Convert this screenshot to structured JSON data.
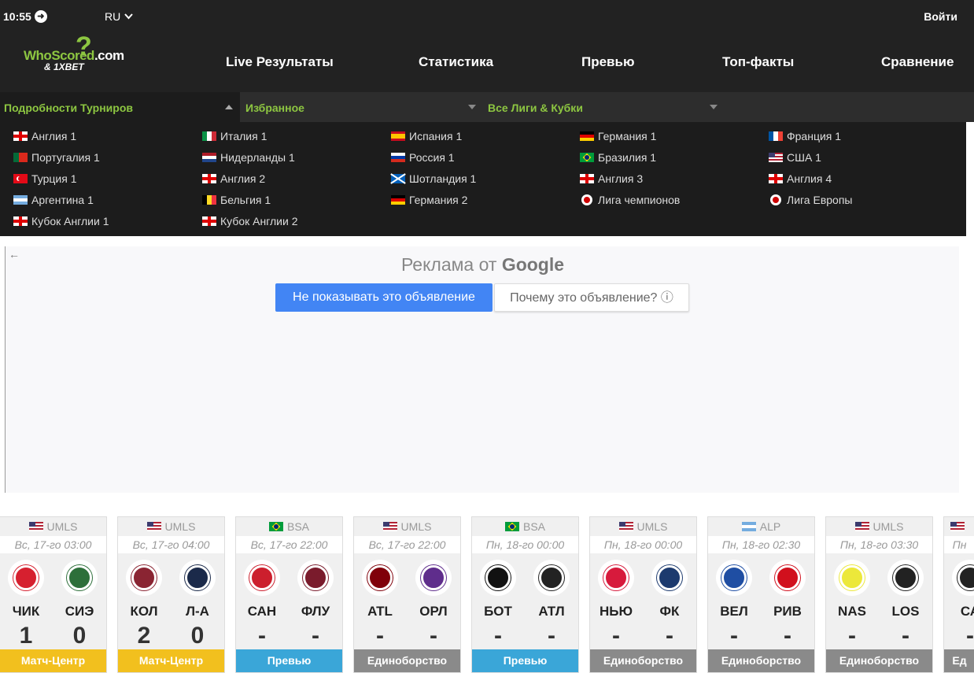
{
  "status": {
    "time": "10:55",
    "lang": "RU",
    "login": "Войти"
  },
  "logo": {
    "part1": "WhoScored",
    "part2": ".com",
    "part3": "& 1XBET"
  },
  "nav": [
    "Live Результаты",
    "Статистика",
    "Превью",
    "Топ-факты",
    "Сравнение"
  ],
  "tabs": {
    "active": "Подробности Турниров",
    "fav": "Избранное",
    "all": "Все Лиги & Кубки"
  },
  "leagues": [
    {
      "name": "Англия 1",
      "flag": "eng"
    },
    {
      "name": "Италия 1",
      "flag": "ita"
    },
    {
      "name": "Испания 1",
      "flag": "esp"
    },
    {
      "name": "Германия 1",
      "flag": "ger"
    },
    {
      "name": "Франция 1",
      "flag": "fra"
    },
    {
      "name": "Португалия 1",
      "flag": "por"
    },
    {
      "name": "Нидерланды 1",
      "flag": "ned"
    },
    {
      "name": "Россия 1",
      "flag": "rus"
    },
    {
      "name": "Бразилия 1",
      "flag": "bra"
    },
    {
      "name": "США 1",
      "flag": "usa"
    },
    {
      "name": "Турция 1",
      "flag": "tur"
    },
    {
      "name": "Англия 2",
      "flag": "eng"
    },
    {
      "name": "Шотландия 1",
      "flag": "sco"
    },
    {
      "name": "Англия 3",
      "flag": "eng"
    },
    {
      "name": "Англия 4",
      "flag": "eng"
    },
    {
      "name": "Аргентина 1",
      "flag": "arg"
    },
    {
      "name": "Бельгия 1",
      "flag": "bel"
    },
    {
      "name": "Германия 2",
      "flag": "ger"
    },
    {
      "name": "Лига чемпионов",
      "flag": "uefa"
    },
    {
      "name": "Лига Европы",
      "flag": "uefa"
    },
    {
      "name": "Кубок Англии 1",
      "flag": "eng"
    },
    {
      "name": "Кубок Англии 2",
      "flag": "eng"
    }
  ],
  "ad": {
    "back": "←",
    "title_prefix": "Реклама от",
    "title_brand": "Google",
    "btn_hide": "Не показывать это объявление",
    "btn_why": "Почему это объявление? ⓘ"
  },
  "matches": [
    {
      "league": "UMLS",
      "flag": "usa",
      "date": "Вс, 17-го 03:00",
      "home": "ЧИК",
      "away": "СИЭ",
      "hs": "1",
      "as": "0",
      "btn": "Матч-Центр",
      "style": "yellow",
      "hc": "#d6202f",
      "ac": "#2d6f3a"
    },
    {
      "league": "UMLS",
      "flag": "usa",
      "date": "Вс, 17-го 04:00",
      "home": "КОЛ",
      "away": "Л-А",
      "hs": "2",
      "as": "0",
      "btn": "Матч-Центр",
      "style": "yellow",
      "hc": "#8a2432",
      "ac": "#1b2a4a"
    },
    {
      "league": "BSA",
      "flag": "bra",
      "date": "Вс, 17-го 22:00",
      "home": "САН",
      "away": "ФЛУ",
      "hs": "-",
      "as": "-",
      "btn": "Превью",
      "style": "blue",
      "hc": "#cc1f2d",
      "ac": "#7a1b2c"
    },
    {
      "league": "UMLS",
      "flag": "usa",
      "date": "Вс, 17-го 22:00",
      "home": "ATL",
      "away": "ОРЛ",
      "hs": "-",
      "as": "-",
      "btn": "Единоборство",
      "style": "gray",
      "hc": "#80000a",
      "ac": "#5f2d8c"
    },
    {
      "league": "BSA",
      "flag": "bra",
      "date": "Пн, 18-го 00:00",
      "home": "БОТ",
      "away": "АТЛ",
      "hs": "-",
      "as": "-",
      "btn": "Превью",
      "style": "blue",
      "hc": "#111111",
      "ac": "#222222"
    },
    {
      "league": "UMLS",
      "flag": "usa",
      "date": "Пн, 18-го 00:00",
      "home": "НЬЮ",
      "away": "ФК",
      "hs": "-",
      "as": "-",
      "btn": "Единоборство",
      "style": "gray",
      "hc": "#d71a3c",
      "ac": "#1c3a6e"
    },
    {
      "league": "ALP",
      "flag": "arg",
      "date": "Пн, 18-го 02:30",
      "home": "ВЕЛ",
      "away": "РИВ",
      "hs": "-",
      "as": "-",
      "btn": "Единоборство",
      "style": "gray",
      "hc": "#1f4ea3",
      "ac": "#d1101d"
    },
    {
      "league": "UMLS",
      "flag": "usa",
      "date": "Пн, 18-го 03:30",
      "home": "NAS",
      "away": "LOS",
      "hs": "-",
      "as": "-",
      "btn": "Единоборство",
      "style": "gray",
      "hc": "#ece83a",
      "ac": "#222222"
    },
    {
      "league": "",
      "flag": "usa",
      "date": "Пн",
      "home": "СА",
      "away": "",
      "hs": "-",
      "as": "",
      "btn": "Ед",
      "style": "gray",
      "hc": "#222222",
      "ac": "#222222"
    }
  ]
}
